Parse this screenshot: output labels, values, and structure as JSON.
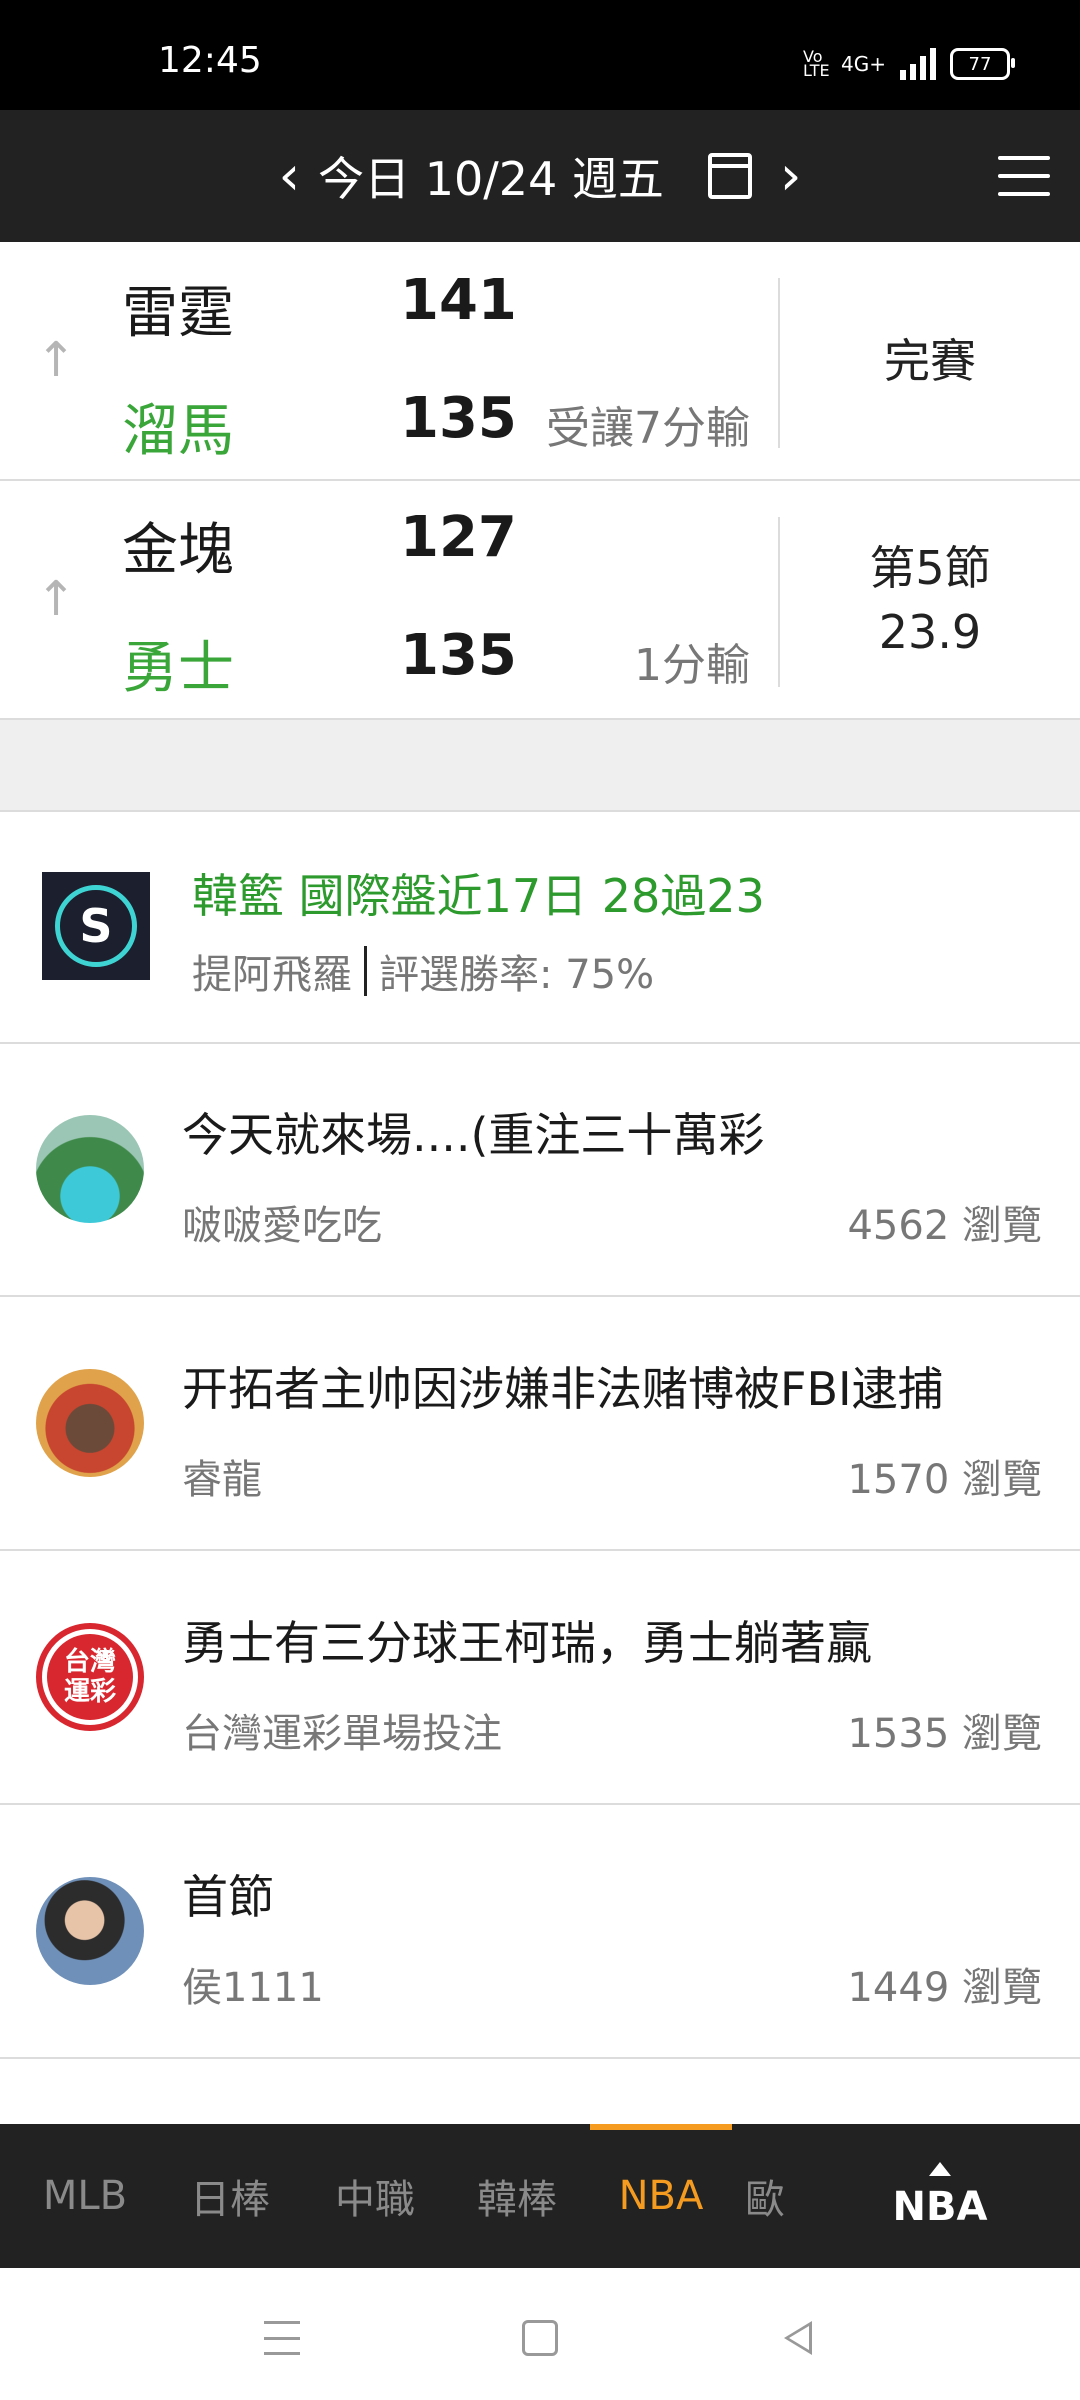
{
  "status_bar": {
    "time": "12:45",
    "network": "4G+",
    "volte": "Vo LTE",
    "battery": "77"
  },
  "header": {
    "prev": "‹",
    "date_text": "今日 10/24 週五",
    "next": "›"
  },
  "games": [
    {
      "away_team": "雷霆",
      "away_score": "141",
      "home_team": "溜馬",
      "home_score": "135",
      "note": "受讓7分輸",
      "status_line1": "完賽",
      "status_line2": ""
    },
    {
      "away_team": "金塊",
      "away_score": "127",
      "home_team": "勇士",
      "home_score": "135",
      "note": "1分輸",
      "status_line1": "第5節",
      "status_line2": "23.9"
    }
  ],
  "pick": {
    "logo_letter": "S",
    "title": "韓籃 國際盤近17日 28過23",
    "author": "提阿飛羅",
    "win_rate": "評選勝率: 75%"
  },
  "posts": [
    {
      "title": "今天就來場....(重注三十萬彩",
      "author": "啵啵愛吃吃",
      "views": "4562 瀏覽"
    },
    {
      "title": "开拓者主帅因涉嫌非法赌博被FBI逮捕",
      "author": "睿龍",
      "views": "1570 瀏覽"
    },
    {
      "title": "勇士有三分球王柯瑞，勇士躺著贏",
      "author": "台灣運彩單場投注",
      "views": "1535 瀏覽",
      "avatar_text": "台灣運彩"
    },
    {
      "title": "首節",
      "author": "侯1111",
      "views": "1449 瀏覽"
    }
  ],
  "tabs": [
    "MLB",
    "日棒",
    "中職",
    "韓棒",
    "NBA",
    "歐"
  ],
  "active_tab": "NBA",
  "right_tab": "NBA",
  "colors": {
    "accent": "#f59b1f",
    "home_team": "#3aa63a",
    "pick_title": "#2c9a2c",
    "header_bg": "#222222"
  }
}
